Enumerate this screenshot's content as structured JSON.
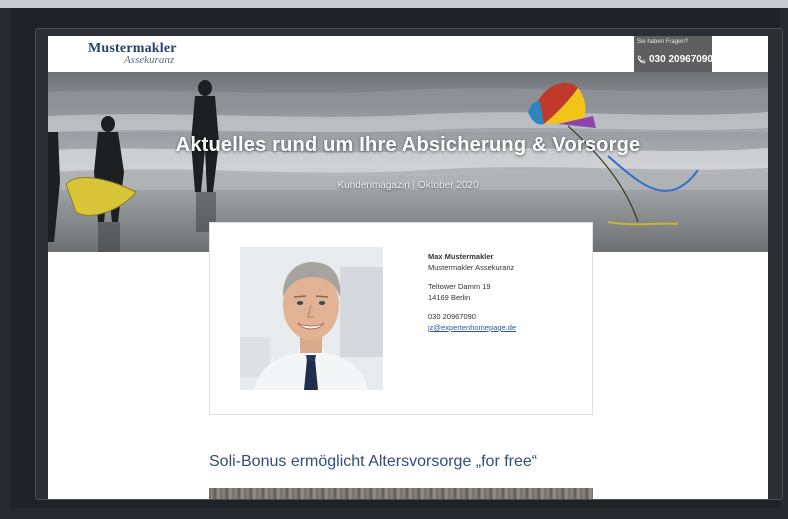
{
  "header": {
    "logo_main": "Mustermakler",
    "logo_sub": "Assekuranz",
    "contact_question": "Sie haben Fragen?",
    "contact_phone": "030 20967090"
  },
  "hero": {
    "title": "Aktuelles rund um Ihre Absicherung & Vorsorge",
    "subtitle": "Kundenmagazin | Oktober 2020"
  },
  "agent": {
    "name": "Max Mustermakler",
    "company": "Mustermakler Assekuranz",
    "street": "Teltower Damm 19",
    "city": "14169 Berlin",
    "phone": "030 20967090",
    "email": "jz@expertenhomepage.de"
  },
  "article": {
    "title": "Soli-Bonus ermöglicht Altersvorsorge „for free“"
  },
  "colors": {
    "brand_navy": "#25406b",
    "article_title": "#2f4d7a",
    "contact_box": "#5f5f5f",
    "link": "#2c5aa0"
  }
}
